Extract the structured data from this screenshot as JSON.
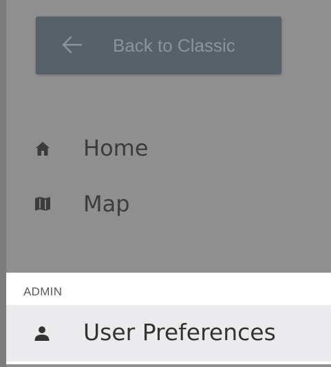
{
  "back_button": {
    "label": "Back to Classic",
    "icon": "arrow-left-icon"
  },
  "nav": {
    "items": [
      {
        "label": "Home",
        "icon": "home-icon"
      },
      {
        "label": "Map",
        "icon": "map-icon"
      }
    ]
  },
  "admin": {
    "header": "ADMIN",
    "items": [
      {
        "label": "User Preferences",
        "icon": "user-icon"
      }
    ]
  },
  "colors": {
    "overlay": "#8f8f8f",
    "button_bg": "#58606a",
    "admin_bg": "#ffffff",
    "active_row_bg": "#ebebed"
  }
}
